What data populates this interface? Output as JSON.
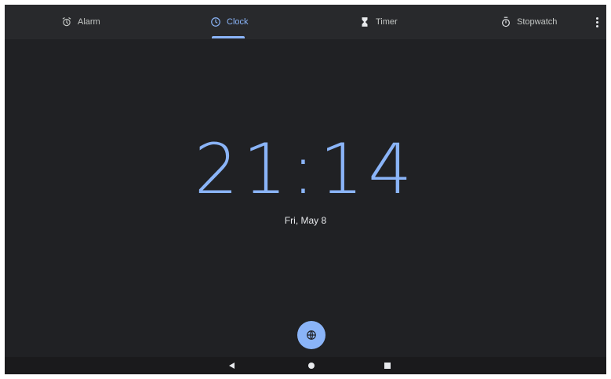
{
  "tabs": [
    {
      "label": "Alarm",
      "icon": "alarm-icon",
      "active": false
    },
    {
      "label": "Clock",
      "icon": "clock-icon",
      "active": true
    },
    {
      "label": "Timer",
      "icon": "hourglass-icon",
      "active": false
    },
    {
      "label": "Stopwatch",
      "icon": "stopwatch-icon",
      "active": false
    }
  ],
  "clock": {
    "time": "21:14",
    "date": "Fri, May 8"
  },
  "fab": {
    "icon": "globe-icon"
  },
  "navigation": {
    "buttons": [
      "back",
      "home",
      "recents"
    ]
  },
  "colors": {
    "accent": "#8ab4f8",
    "background": "#202124",
    "tabbar": "#28292c",
    "text": "#e8eaed",
    "inactive": "#c4c7c5"
  }
}
